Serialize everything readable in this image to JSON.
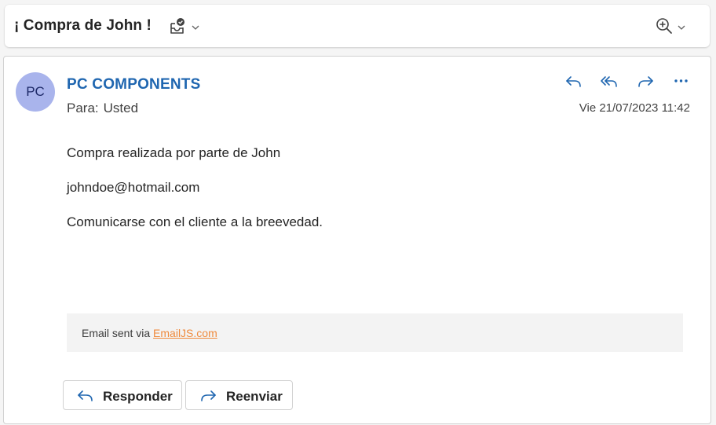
{
  "header": {
    "subject": "¡ Compra de John !",
    "icons": [
      "envelope-check-icon",
      "chevron-down-icon",
      "zoom-in-icon",
      "chevron-down-icon"
    ]
  },
  "message": {
    "avatar_initials": "PC",
    "sender": "PC COMPONENTS",
    "to_label": "Para:",
    "to_value": "Usted",
    "date": "Vie 21/07/2023 11:42",
    "actions": [
      "reply-icon",
      "reply-all-icon",
      "forward-icon",
      "more-icon"
    ],
    "body": [
      "Compra realizada por parte de John",
      "johndoe@hotmail.com",
      "Comunicarse con el cliente a la breevedad."
    ],
    "footer_text": "Email sent via ",
    "footer_link": "EmailJS.com"
  },
  "buttons": {
    "reply": "Responder",
    "forward": "Reenviar"
  },
  "colors": {
    "sender": "#1f66b0",
    "avatar_bg": "#a9b4ec",
    "link": "#ef8a3c",
    "icon": "#1f66b0"
  }
}
